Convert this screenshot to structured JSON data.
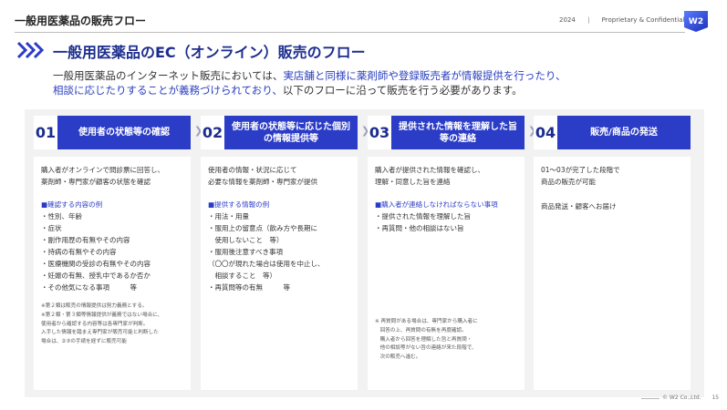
{
  "header": {
    "title": "一般用医薬品の販売フロー",
    "year": "2024",
    "separator": "|",
    "confidential": "Proprietary & Confidential",
    "logo_text": "W2"
  },
  "section": {
    "heading": "一般用医薬品のEC（オンライン）販売のフロー",
    "lead": {
      "line1_plain": "一般用医薬品のインターネット販売においては、",
      "line1_highlight": "実店舗と同様に薬剤師や登録販売者が情報提供を行ったり、",
      "line2_highlight": "相談に応じたりすることが義務づけられており、",
      "line2_plain": "以下のフローに沿って販売を行う必要があります。"
    }
  },
  "steps": [
    {
      "num": "01",
      "label": "使用者の状態等の確認",
      "lines": [
        "購入者がオンラインで問診票に回答し、",
        "薬剤師・専門家が顧客の状態を確認"
      ],
      "section_head": "■確認する内容の例",
      "items": [
        "・性別、年齢",
        "・症状",
        "・副作用歴の有無やその内容",
        "・持病の有無やその内容",
        "・医療機関の受診の有無やその内容",
        "・妊娠の有無、授乳中であるか否か",
        "・その他気になる事項　　　等"
      ],
      "notes": [
        "※第２類は販売の情報提供は努力義務とする。",
        "※第２類・第３類等情報提供が義務ではない場合に、",
        "使用者から確認する内容等は各専門家が判断。",
        "入手した情報を踏まえ専門家が販売可能と判断した",
        "場合は、②③の手続を経ずに販売可能"
      ]
    },
    {
      "num": "02",
      "label": "使用者の状態等に応じた個別の情報提供等",
      "lines": [
        "使用者の情報・状況に応じて",
        "必要な情報を薬剤師・専門家が提供"
      ],
      "section_head": "■提供する情報の例",
      "items": [
        "・用法・用量",
        "・服用上の留意点（飲み方や長期に",
        "　使用しないこと　等）",
        "・服用後注意すべき事項",
        "（〇〇が現れた場合は使用を中止し、",
        "　相談すること　等）",
        "・再質問等の有無　　　等"
      ],
      "notes": []
    },
    {
      "num": "03",
      "label": "提供された情報を理解した旨等の連絡",
      "lines": [
        "購入者が提供された情報を確認し、",
        "理解・同意した旨を連絡"
      ],
      "section_head": "■購入者が連絡しなければならない事項",
      "items": [
        "・提供された情報を理解した旨",
        "・再質問・他の相談はない旨"
      ],
      "notes": [
        "※ 再質問がある場合は、専門家から購入者に",
        "　回答の上、再質問の有無を再度確認。",
        "　購入者から回答を理解した旨と再質問・",
        "　他の相談等がない旨の連絡が来た段階で、",
        "　次の販売へ進む。"
      ]
    },
    {
      "num": "04",
      "label": "販売/商品の発送",
      "lines": [
        "01〜03が完了した段階で",
        "商品の販売が可能"
      ],
      "section_head": "",
      "items": [
        "商品発送・顧客へお届け"
      ],
      "notes": []
    }
  ],
  "footer": {
    "copyright": "© W2 Co.,Ltd.",
    "page": "15"
  },
  "colors": {
    "accent": "#2b3cc7",
    "heading": "#1c2d8e",
    "panel": "#f2f2f2"
  }
}
